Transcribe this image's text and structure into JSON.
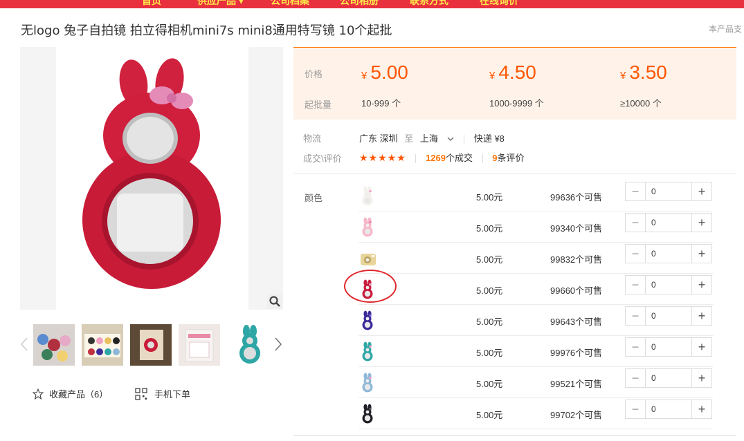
{
  "nav": {
    "items": [
      "首页",
      "供应产品",
      "公司档案",
      "公司相册",
      "联系方式",
      "在线询价"
    ]
  },
  "product": {
    "title": "无logo 兔子自拍镜 拍立得相机mini7s mini8通用特写镜 10个起批",
    "right_note": "本产品支"
  },
  "gallery": {
    "thumbnails": [
      "thumb-1",
      "thumb-2",
      "thumb-3",
      "thumb-4",
      "thumb-5"
    ]
  },
  "actions": {
    "favorite": "收藏产品（6）",
    "mobile_order": "手机下单"
  },
  "pricing": {
    "price_label": "价格",
    "moq_label": "起批量",
    "currency": "¥",
    "tiers": [
      {
        "price": "5.00",
        "range": "10-999 个"
      },
      {
        "price": "4.50",
        "range": "1000-9999 个"
      },
      {
        "price": "3.50",
        "range": "≥10000 个"
      }
    ]
  },
  "logistics": {
    "label": "物流",
    "from_province": "广东",
    "from_city": "深圳",
    "to_word": "至",
    "to_city": "上海",
    "shipping": "快递",
    "shipping_cost": "¥8"
  },
  "reviews": {
    "label": "成交\\评价",
    "stars": "★★★★★",
    "deals_count": "1269",
    "deals_suffix": "个成交",
    "review_count": "9",
    "review_suffix": "条评价"
  },
  "sku": {
    "label": "颜色",
    "rows": [
      {
        "icon": "white-rabbit-mirror",
        "color": "#f4f1ec",
        "accent": "#f2a4c8",
        "price": "5.00元",
        "stock": "99636个可售",
        "qty": "0"
      },
      {
        "icon": "pink-rabbit-mirror",
        "color": "#f6b8c9",
        "accent": "#e889aa",
        "price": "5.00元",
        "stock": "99340个可售",
        "qty": "0"
      },
      {
        "icon": "yellow-camera-mirror",
        "color": "#e8d59a",
        "accent": "#b9a05c",
        "price": "5.00元",
        "stock": "99832个可售",
        "qty": "0"
      },
      {
        "icon": "red-rabbit-mirror",
        "color": "#c81e3c",
        "accent": "#e8a0c0",
        "price": "5.00元",
        "stock": "99660个可售",
        "qty": "0"
      },
      {
        "icon": "purple-rabbit-mirror",
        "color": "#3a2a9a",
        "accent": "#7b6ad0",
        "price": "5.00元",
        "stock": "99643个可售",
        "qty": "0"
      },
      {
        "icon": "teal-rabbit-mirror",
        "color": "#2ea6a6",
        "accent": "#f2a4c8",
        "price": "5.00元",
        "stock": "99976个可售",
        "qty": "0"
      },
      {
        "icon": "lightblue-rabbit-mirror",
        "color": "#8fb8d8",
        "accent": "#f2a4c8",
        "price": "5.00元",
        "stock": "99521个可售",
        "qty": "0"
      },
      {
        "icon": "black-rabbit-mirror",
        "color": "#1e1e26",
        "accent": "#555",
        "price": "5.00元",
        "stock": "99702个可售",
        "qty": "0"
      }
    ],
    "minus": "−",
    "plus": "+"
  },
  "colors": {
    "brand_red": "#e8303e",
    "nav_text": "#ffe94a",
    "price_orange": "#ff5500",
    "panel_bg": "#fff3e9"
  }
}
